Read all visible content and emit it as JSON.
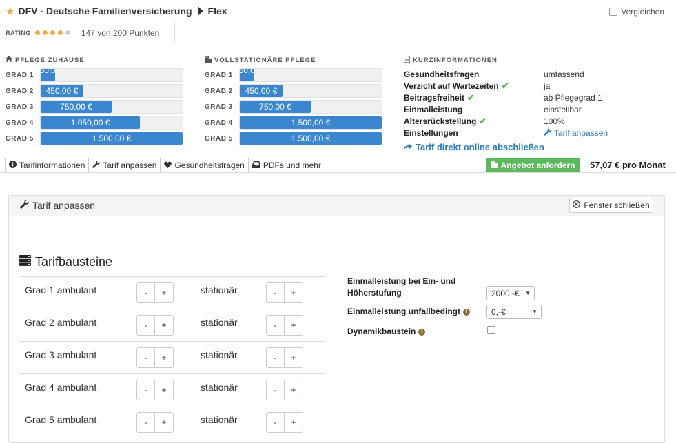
{
  "header": {
    "provider": "DFV - Deutsche Familienversicherung",
    "tariff": "Flex",
    "compare_label": "Vergleichen"
  },
  "rating": {
    "label": "RATING",
    "dots_filled": 4,
    "dots_total": 5,
    "text": "147 von 200 Punkten"
  },
  "pflege_zuhause": {
    "title": "PFLEGE ZUHAUSE",
    "grades": [
      {
        "label": "GRAD 1",
        "value": "150,00 €",
        "fraction": 0.1
      },
      {
        "label": "GRAD 2",
        "value": "450,00 €",
        "fraction": 0.3
      },
      {
        "label": "GRAD 3",
        "value": "750,00 €",
        "fraction": 0.5
      },
      {
        "label": "GRAD 4",
        "value": "1.050,00 €",
        "fraction": 0.7
      },
      {
        "label": "GRAD 5",
        "value": "1.500,00 €",
        "fraction": 1.0
      }
    ]
  },
  "vollstationaer": {
    "title": "VOLLSTATIONÄRE PFLEGE",
    "grades": [
      {
        "label": "GRAD 1",
        "value": "150,00 €",
        "fraction": 0.1
      },
      {
        "label": "GRAD 2",
        "value": "450,00 €",
        "fraction": 0.3
      },
      {
        "label": "GRAD 3",
        "value": "750,00 €",
        "fraction": 0.5
      },
      {
        "label": "GRAD 4",
        "value": "1.500,00 €",
        "fraction": 1.0
      },
      {
        "label": "GRAD 5",
        "value": "1.500,00 €",
        "fraction": 1.0
      }
    ]
  },
  "kurzinfo": {
    "title": "KURZINFORMATIONEN",
    "rows": [
      {
        "key": "Gesundheitsfragen",
        "value": "umfassend",
        "check": false
      },
      {
        "key": "Verzicht auf Wartezeiten",
        "value": "ja",
        "check": true
      },
      {
        "key": "Beitragsfreiheit",
        "value": "ab Pflegegrad 1",
        "check": true
      },
      {
        "key": "Einmalleistung",
        "value": "einstellbar",
        "check": false
      },
      {
        "key": "Altersrückstellung",
        "value": "100%",
        "check": true
      },
      {
        "key": "Einstellungen",
        "value": "Tarif anpassen",
        "check": false
      }
    ],
    "online_link": "Tarif direkt online abschließen"
  },
  "tabs": [
    {
      "label": "Tarifinformationen",
      "icon": "info-circle-icon"
    },
    {
      "label": "Tarif anpassen",
      "icon": "wrench-icon"
    },
    {
      "label": "Gesundheitsfragen",
      "icon": "heart-icon"
    },
    {
      "label": "PDFs und mehr",
      "icon": "inbox-icon"
    }
  ],
  "offer": {
    "button_label": "Angebot anfordern",
    "price": "57,07 € pro Monat"
  },
  "panel": {
    "title": "Tarif anpassen",
    "close_label": "Fenster schließen",
    "section_title": "Tarifbausteine",
    "rows": [
      {
        "label": "Grad 1 ambulant",
        "label2": "stationär"
      },
      {
        "label": "Grad 2 ambulant",
        "label2": "stationär"
      },
      {
        "label": "Grad 3 ambulant",
        "label2": "stationär"
      },
      {
        "label": "Grad 4 ambulant",
        "label2": "stationär"
      },
      {
        "label": "Grad 5 ambulant",
        "label2": "stationär"
      }
    ],
    "minus": "-",
    "plus": "+",
    "options": {
      "einmal_ein_label_1": "Einmalleistung bei Ein- und",
      "einmal_ein_label_2": "Höherstufung",
      "einmal_ein_value": "2000,-€",
      "einmal_unfall_label": "Einmalleistung unfallbedingt",
      "einmal_unfall_value": "0,-€",
      "dynamik_label": "Dynamikbaustein",
      "dynamik_checked": false
    }
  },
  "colors": {
    "accent": "#3a87cf",
    "success": "#5cb85c",
    "star": "#f0ad4e"
  }
}
